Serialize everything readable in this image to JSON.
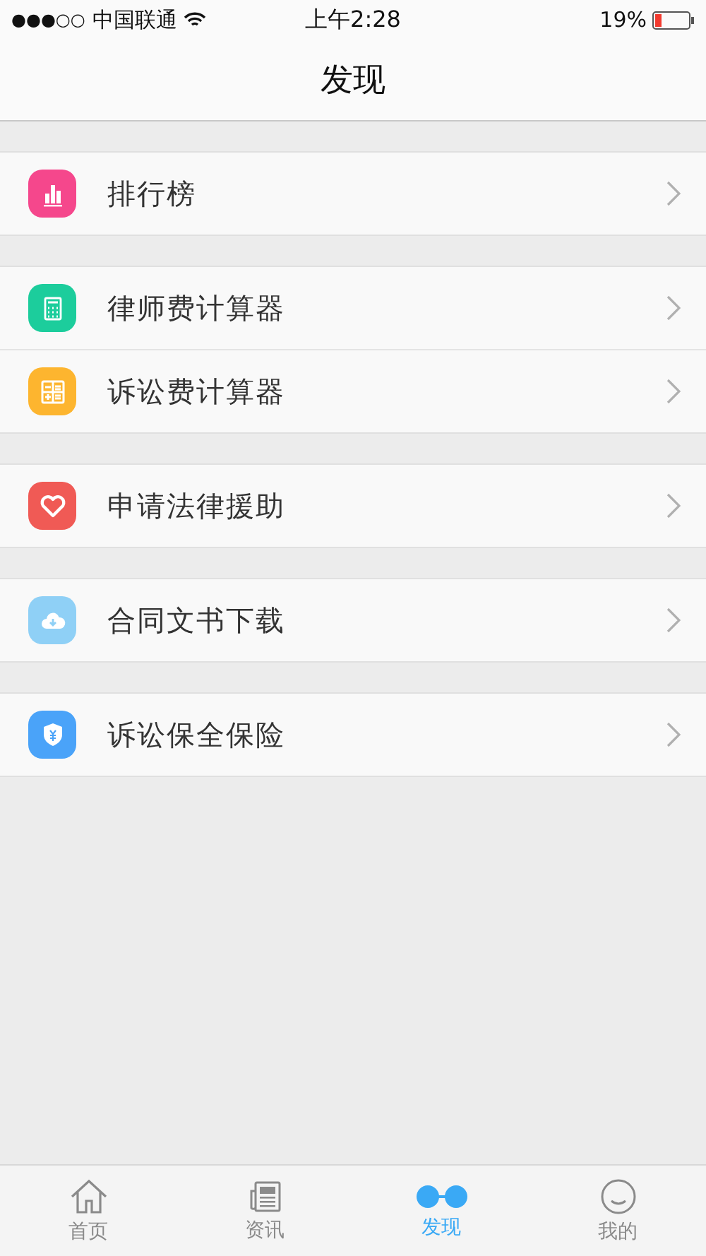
{
  "status_bar": {
    "signal_dots": "●●●○○",
    "carrier": "中国联通",
    "time": "上午2:28",
    "battery": "19%"
  },
  "nav_bar": {
    "title": "发现"
  },
  "sections": [
    {
      "items": [
        {
          "kind": "chart",
          "label": "排行榜",
          "color": "#f5478c"
        }
      ]
    },
    {
      "items": [
        {
          "kind": "calculator",
          "label": "律师费计算器",
          "color": "#1ccd9c"
        },
        {
          "kind": "calc-grid",
          "label": "诉讼费计算器",
          "color": "#fdb52f"
        }
      ]
    },
    {
      "items": [
        {
          "kind": "heart",
          "label": "申请法律援助",
          "color": "#f05a55"
        }
      ]
    },
    {
      "items": [
        {
          "kind": "cloud",
          "label": "合同文书下载",
          "color": "#8fd0f6"
        }
      ]
    },
    {
      "items": [
        {
          "kind": "shield",
          "label": "诉讼保全保险",
          "color": "#4aa3f9"
        }
      ]
    }
  ],
  "tab_bar": [
    {
      "kind": "home",
      "label": "首页",
      "selected": false
    },
    {
      "kind": "news",
      "label": "资讯",
      "selected": false
    },
    {
      "kind": "discover",
      "label": "发现",
      "selected": true
    },
    {
      "kind": "profile",
      "label": "我的",
      "selected": false
    }
  ]
}
